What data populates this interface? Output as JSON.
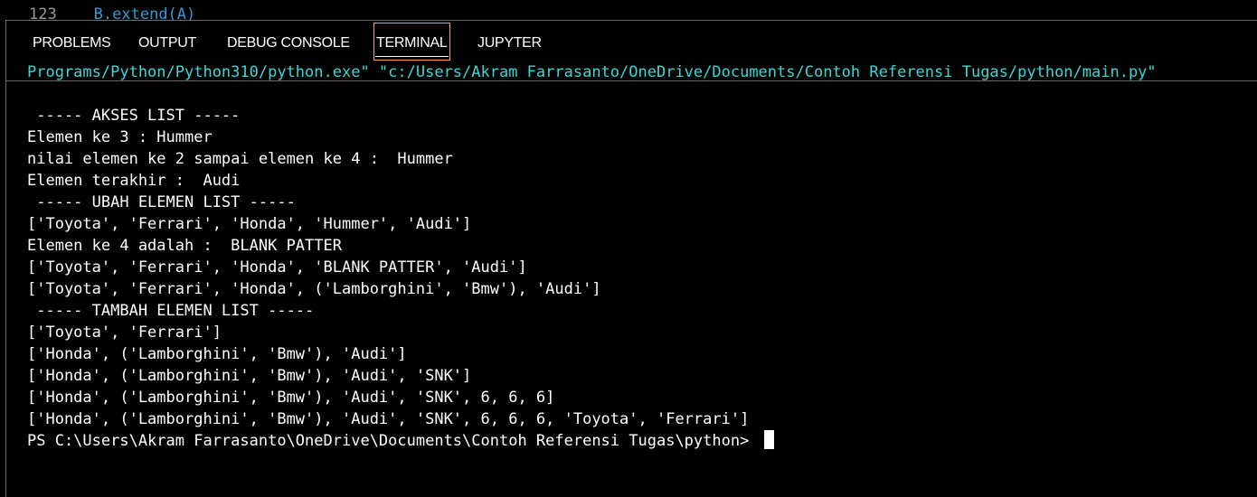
{
  "editor": {
    "partial_line_number": "123",
    "partial_code": "B.extend(A)"
  },
  "panel": {
    "tabs": [
      {
        "label": "PROBLEMS",
        "active": false
      },
      {
        "label": "OUTPUT",
        "active": false
      },
      {
        "label": "DEBUG CONSOLE",
        "active": false
      },
      {
        "label": "TERMINAL",
        "active": true
      },
      {
        "label": "JUPYTER",
        "active": false
      }
    ],
    "accent_color": "#f2a541"
  },
  "terminal": {
    "command_tail": "Programs/Python/Python310/python.exe\" \"c:/Users/Akram Farrasanto/OneDrive/Documents/Contoh Referensi Tugas/python/main.py\"",
    "lines": [
      "",
      " ----- AKSES LIST -----",
      "Elemen ke 3 : Hummer",
      "nilai elemen ke 2 sampai elemen ke 4 :  Hummer",
      "Elemen terakhir :  Audi",
      " ----- UBAH ELEMEN LIST -----",
      "['Toyota', 'Ferrari', 'Honda', 'Hummer', 'Audi']",
      "Elemen ke 4 adalah :  BLANK PATTER",
      "['Toyota', 'Ferrari', 'Honda', 'BLANK PATTER', 'Audi']",
      "['Toyota', 'Ferrari', 'Honda', ('Lamborghini', 'Bmw'), 'Audi']",
      " ----- TAMBAH ELEMEN LIST -----",
      "['Toyota', 'Ferrari']",
      "['Honda', ('Lamborghini', 'Bmw'), 'Audi']",
      "['Honda', ('Lamborghini', 'Bmw'), 'Audi', 'SNK']",
      "['Honda', ('Lamborghini', 'Bmw'), 'Audi', 'SNK', 6, 6, 6]",
      "['Honda', ('Lamborghini', 'Bmw'), 'Audi', 'SNK', 6, 6, 6, 'Toyota', 'Ferrari']"
    ],
    "prompt": "PS C:\\Users\\Akram Farrasanto\\OneDrive\\Documents\\Contoh Referensi Tugas\\python> ",
    "command_color": "#3ad7d7",
    "text_color": "#ffffff"
  }
}
